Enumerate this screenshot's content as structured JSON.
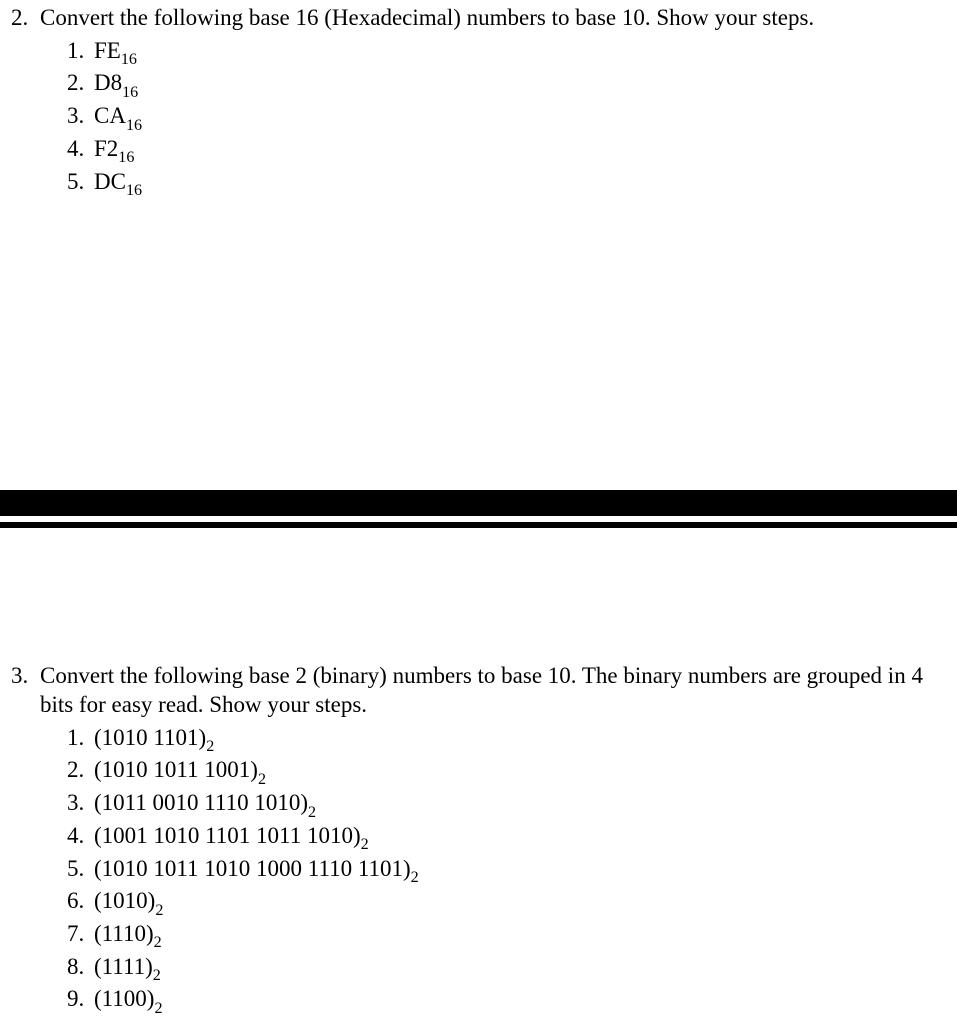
{
  "q2": {
    "number": "2",
    "prompt": "Convert the following base 16 (Hexadecimal) numbers to base 10. Show your steps.",
    "items": [
      {
        "value": "FE",
        "base": "16"
      },
      {
        "value": "D8",
        "base": "16"
      },
      {
        "value": "CA",
        "base": "16"
      },
      {
        "value": "F2",
        "base": "16"
      },
      {
        "value": "DC",
        "base": "16"
      }
    ]
  },
  "q3": {
    "number": "3",
    "prompt": "Convert the following base 2 (binary) numbers to base 10. The binary numbers are grouped in 4 bits for easy read. Show your steps.",
    "items": [
      {
        "value": "(1010 1101)",
        "base": "2"
      },
      {
        "value": "(1010 1011 1001)",
        "base": "2"
      },
      {
        "value": "(1011 0010 1110 1010)",
        "base": "2"
      },
      {
        "value": "(1001 1010 1101 1011 1010)",
        "base": "2"
      },
      {
        "value": "(1010 1011 1010 1000 1110 1101)",
        "base": "2"
      },
      {
        "value": "(1010)",
        "base": "2"
      },
      {
        "value": "(1110)",
        "base": "2"
      },
      {
        "value": "(1111)",
        "base": "2"
      },
      {
        "value": "(1100)",
        "base": "2"
      }
    ]
  }
}
